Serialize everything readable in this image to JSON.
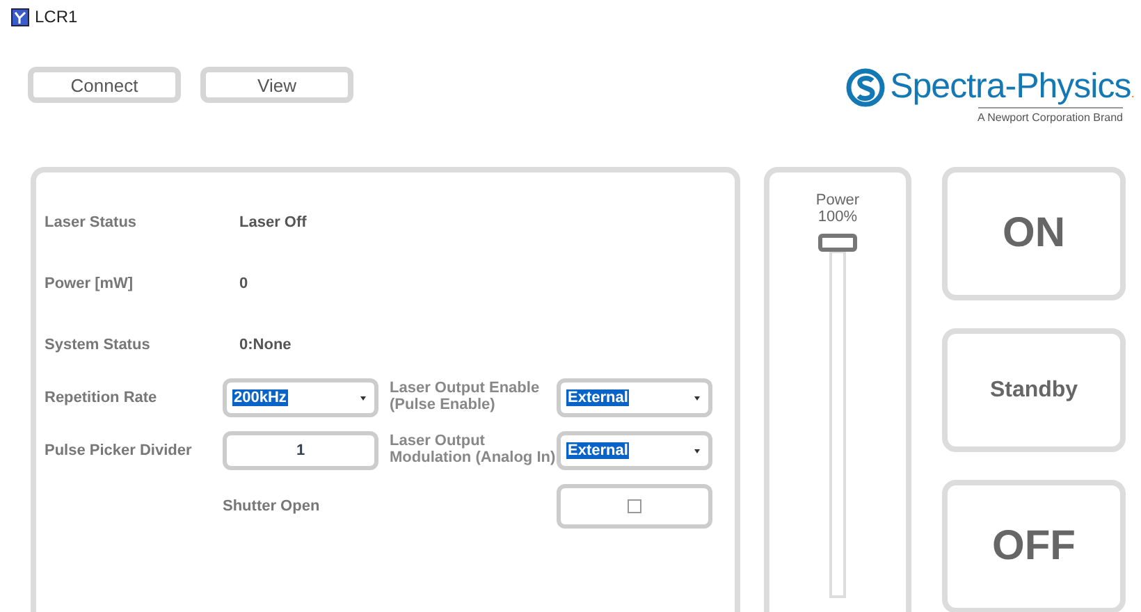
{
  "window": {
    "title": "LCR1"
  },
  "toolbar": [
    "Connect",
    "View"
  ],
  "logo": {
    "name": "Spectra-Physics",
    "mark": ".",
    "tagline": "A Newport Corporation Brand"
  },
  "status": [
    {
      "label": "Laser Status",
      "value": "Laser Off"
    },
    {
      "label": "Power [mW]",
      "value": "0"
    },
    {
      "label": "System Status",
      "value": "0:None"
    }
  ],
  "settings": {
    "repetition_rate": {
      "label": "Repetition Rate",
      "value": "200kHz"
    },
    "pulse_picker_divider": {
      "label": "Pulse Picker Divider",
      "value": "1"
    },
    "laser_output_enable": {
      "label": "Laser Output Enable (Pulse Enable)",
      "value": "External"
    },
    "laser_output_modulation": {
      "label": "Laser Output Modulation (Analog In)",
      "value": "External"
    },
    "shutter_open": {
      "label": "Shutter Open",
      "checked": false
    }
  },
  "power_slider": {
    "label": "Power",
    "reading": "100%",
    "level": 1
  },
  "actions": [
    {
      "label": "ON",
      "kind": "large"
    },
    {
      "label": "Standby",
      "kind": "small"
    },
    {
      "label": "OFF",
      "kind": "large"
    }
  ]
}
